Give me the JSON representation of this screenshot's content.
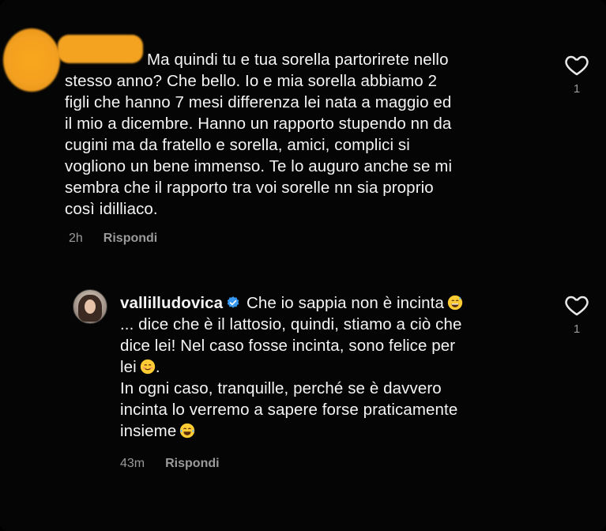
{
  "comments": [
    {
      "author_redacted": true,
      "text_line1": "Ma quindi tu e tua sorella partorirete nello",
      "text_rest": "stesso anno? Che bello.  Io e mia sorella abbiamo 2\nfigli che hanno 7 mesi differenza lei nata a maggio ed\nil mio a dicembre.  Hanno un rapporto stupendo nn da\ncugini ma da fratello e sorella, amici, complici si\nvogliono un bene immenso.  Te lo auguro anche se mi\nsembra che il rapporto tra voi sorelle nn sia proprio\ncosì idilliaco.",
      "time": "2h",
      "reply_label": "Rispondi",
      "like_count": "1"
    },
    {
      "username": "vallilludovica",
      "part1": "Che io sappia non è incinta",
      "part2": "\n... dice che è il lattosio, quindi, stiamo a ciò che\ndice lei! Nel caso fosse incinta, sono felice per\nlei",
      "part3": ".\nIn ogni caso, tranquille, perché se è davvero\nincinta lo verremo a sapere forse praticamente\ninsieme",
      "time": "43m",
      "reply_label": "Rispondi",
      "like_count": "1",
      "emojis": [
        "grinning-sweat-emoji",
        "smiling-blush-emoji",
        "tears-of-joy-emoji"
      ]
    }
  ],
  "icons": {
    "like": "heart-outline-icon",
    "verified": "verified-badge-icon"
  },
  "colors": {
    "background": "#050505",
    "text": "#f4f4f4",
    "muted": "#9a9a9a",
    "verified": "#3897f0",
    "redaction": "#f4a321"
  }
}
